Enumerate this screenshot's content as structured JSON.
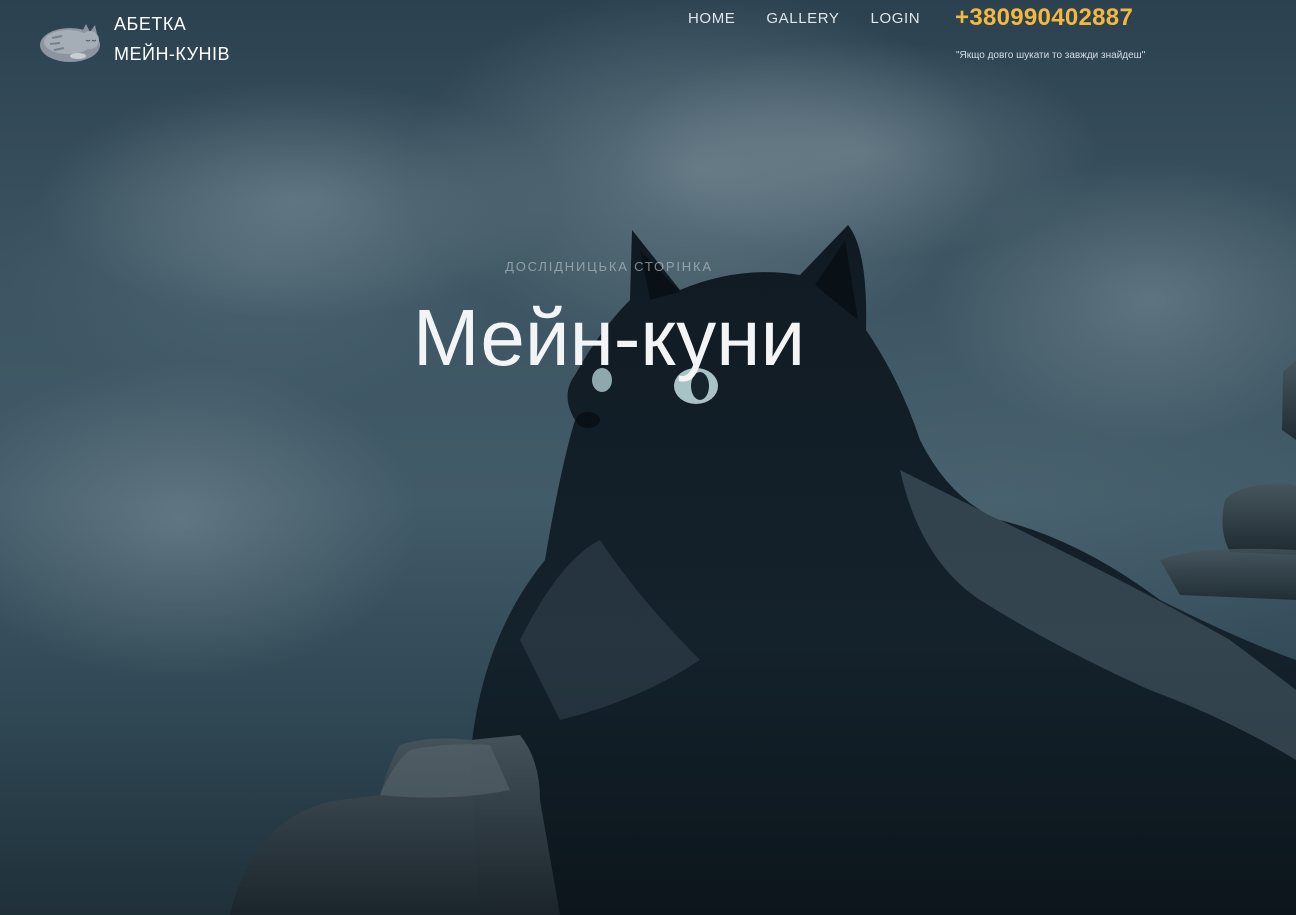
{
  "brand": {
    "line1": "АБЕТКА",
    "line2": "МЕЙН-КУНІВ",
    "logo_icon": "sleeping-cat-icon"
  },
  "nav": {
    "items": [
      {
        "label": "HOME"
      },
      {
        "label": "GALLERY"
      },
      {
        "label": "LOGIN"
      }
    ]
  },
  "contact": {
    "phone": "+380990402887",
    "motto": "\"Якщо довго шукати то завжди знайдеш\""
  },
  "hero": {
    "subtitle": "ДОСЛІДНИЦЬКА СТОРІНКА",
    "title": "Мейн-куни",
    "background_image": "black-maine-coon-cat-on-rocks"
  },
  "colors": {
    "accent_phone": "#f4b93c",
    "text_light": "#ffffff"
  }
}
